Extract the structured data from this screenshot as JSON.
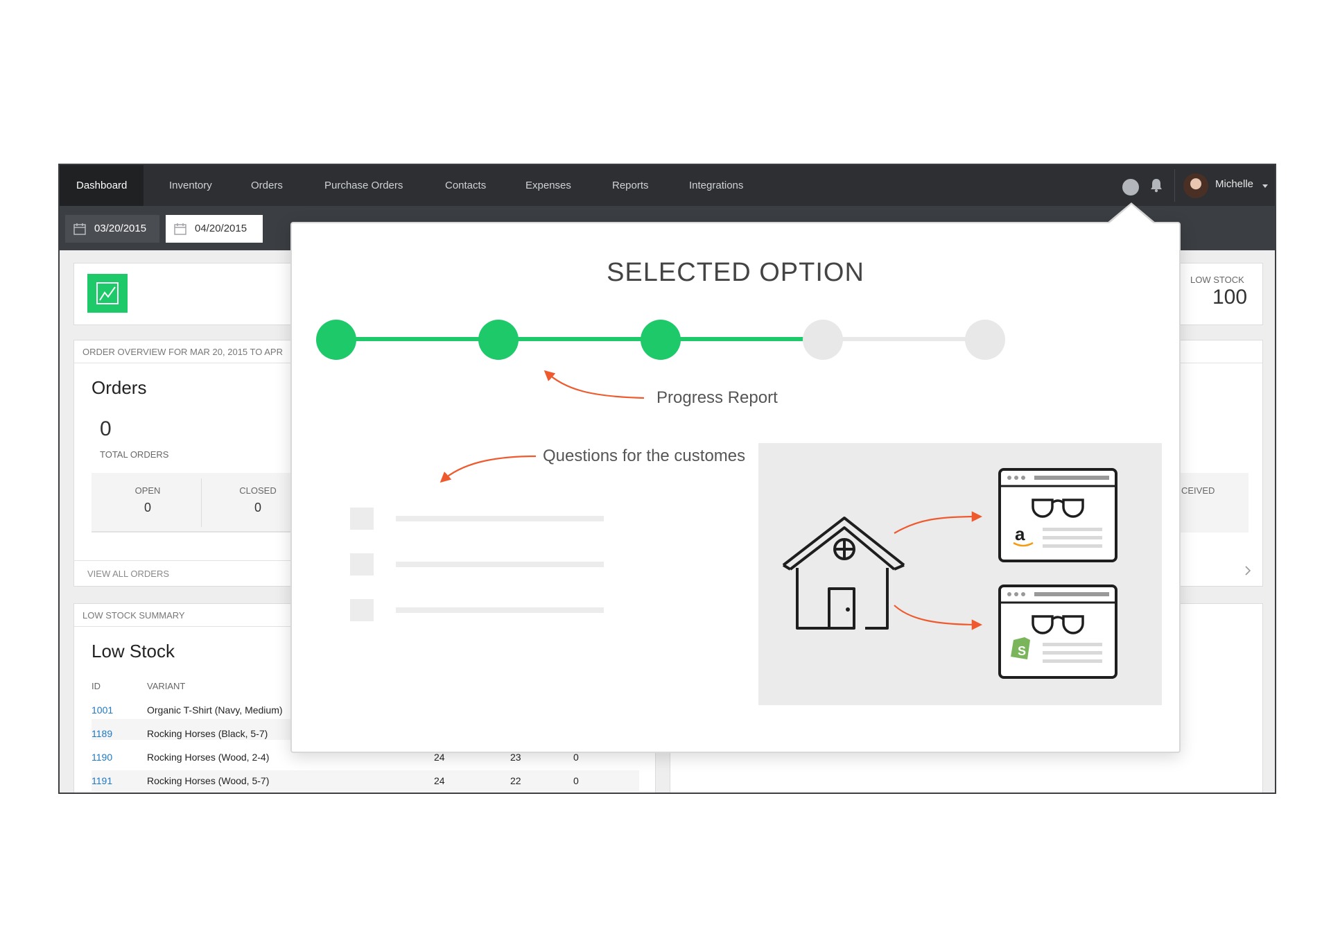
{
  "nav": {
    "items": [
      {
        "label": "Dashboard",
        "active": true
      },
      {
        "label": "Inventory"
      },
      {
        "label": "Orders"
      },
      {
        "label": "Purchase Orders"
      },
      {
        "label": "Contacts"
      },
      {
        "label": "Expenses"
      },
      {
        "label": "Reports"
      },
      {
        "label": "Integrations"
      }
    ],
    "user_name": "Michelle",
    "icons": [
      "status-dot-icon",
      "bell-icon",
      "avatar",
      "chevron-down-icon"
    ]
  },
  "dates": {
    "start": "03/20/2015",
    "end": "04/20/2015"
  },
  "low_stock_stat": {
    "label": "LOW STOCK",
    "value": "100"
  },
  "orders_card": {
    "header": "ORDER OVERVIEW FOR MAR 20, 2015 TO APR",
    "title": "Orders",
    "total_value": "0",
    "total_label": "TOTAL ORDERS",
    "open_label": "OPEN",
    "open_value": "0",
    "closed_label": "CLOSED",
    "closed_value": "0",
    "view_all": "VIEW ALL ORDERS"
  },
  "right_partial": {
    "received_label": "CEIVED"
  },
  "low_stock_card": {
    "header": "LOW STOCK SUMMARY",
    "title": "Low Stock",
    "columns": [
      "ID",
      "VARIANT"
    ],
    "rows": [
      {
        "id": "1001",
        "variant": "Organic T-Shirt (Navy, Medium)",
        "c1": "",
        "c2": "",
        "c3": ""
      },
      {
        "id": "1189",
        "variant": "Rocking Horses (Black, 5-7)",
        "c1": "",
        "c2": "",
        "c3": ""
      },
      {
        "id": "1190",
        "variant": "Rocking Horses (Wood, 2-4)",
        "c1": "24",
        "c2": "23",
        "c3": "0"
      },
      {
        "id": "1191",
        "variant": "Rocking Horses (Wood, 5-7)",
        "c1": "24",
        "c2": "22",
        "c3": "0"
      }
    ]
  },
  "popover": {
    "title": "SELECTED OPTION",
    "progress": {
      "total_steps": 5,
      "completed_steps": 3
    },
    "annotation_progress": "Progress Report",
    "annotation_questions": "Questions for the customes",
    "accent_color": "#1ec96a",
    "arrow_color": "#ee5a2e",
    "inactive_color": "#e8e8e8",
    "illustration_icons": [
      "house-icon",
      "amazon-store-icon",
      "shopify-store-icon",
      "glasses-icon"
    ]
  },
  "colors": {
    "nav_bg": "#2d2f32",
    "link_blue": "#1c78c8"
  }
}
